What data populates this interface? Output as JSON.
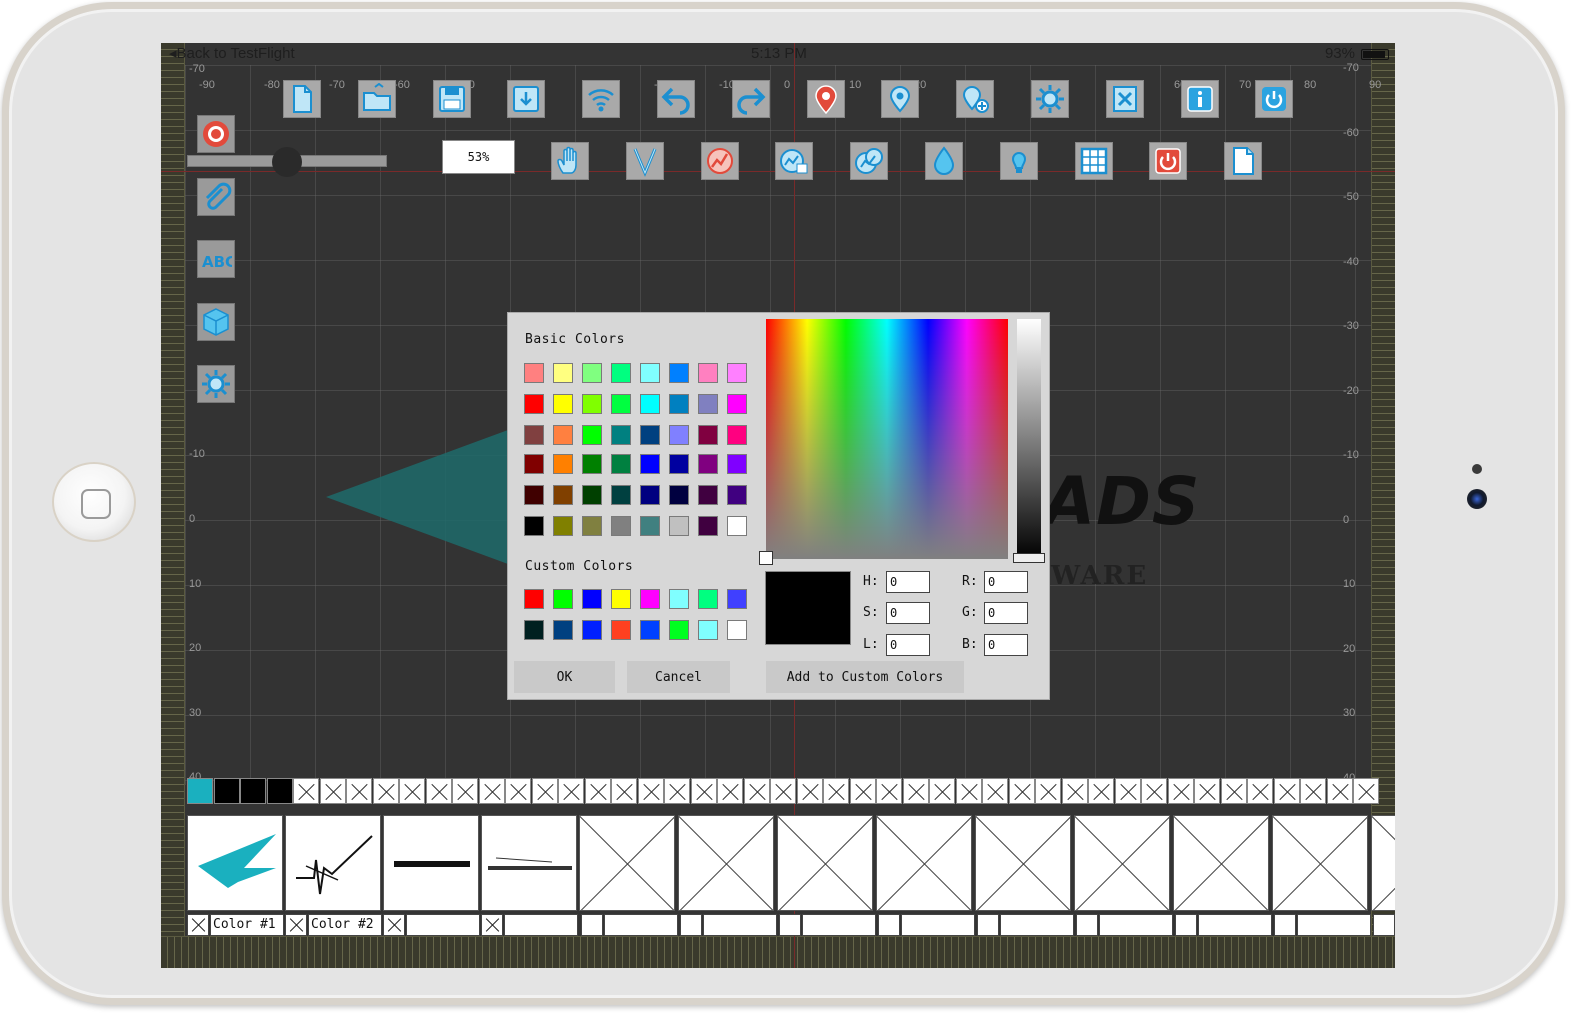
{
  "status_bar": {
    "back": "Back to TestFlight",
    "time": "5:13 PM",
    "battery": "93%"
  },
  "ruler": {
    "top": [
      "-90",
      "-80",
      "-70",
      "-60",
      "-50",
      "-40",
      "-30",
      "-20",
      "-10",
      "0",
      "10",
      "20",
      "30",
      "40",
      "50",
      "60",
      "70",
      "80",
      "90"
    ],
    "right": [
      "-70",
      "-60",
      "-50",
      "-40",
      "-30",
      "-20",
      "-10",
      "0",
      "10",
      "20",
      "30",
      "40"
    ],
    "left": [
      "-70",
      "-10",
      "0",
      "10",
      "20",
      "30",
      "40"
    ]
  },
  "toolbar": {
    "row1": [
      "new-file-icon",
      "open-folder-icon",
      "save-icon",
      "save-as-icon",
      "wireless-icon",
      "undo-icon",
      "redo-icon",
      "map-pin-icon",
      "location-icon",
      "add-location-icon",
      "settings-gear-icon",
      "close-file-icon",
      "info-icon",
      "power-icon"
    ],
    "row2": [
      "hand-icon",
      "needle-v-icon",
      "stitch-curve-icon",
      "stitch-chart-icon",
      "stitch-loop-icon",
      "color-drop-icon",
      "bulb-icon",
      "grid-icon",
      "power-off-icon",
      "page-icon"
    ]
  },
  "side_toolbar": [
    "target-icon",
    "paperclip-icon",
    "abc-text-icon",
    "cube-icon",
    "gear-icon"
  ],
  "zoom": {
    "value": "53%",
    "slider_level": 0.5
  },
  "artwork": {
    "text_main": "ADS",
    "text_sub": "WARE"
  },
  "color_dialog": {
    "basic_colors_label": "Basic Colors",
    "custom_colors_label": "Custom Colors",
    "basic_colors": [
      [
        "#ff8080",
        "#ffff80",
        "#80ff80",
        "#00ff80",
        "#80ffff",
        "#0080ff",
        "#ff80c0",
        "#ff80ff"
      ],
      [
        "#ff0000",
        "#ffff00",
        "#80ff00",
        "#00ff40",
        "#00ffff",
        "#0080c0",
        "#8080c0",
        "#ff00ff"
      ],
      [
        "#804040",
        "#ff8040",
        "#00ff00",
        "#008080",
        "#004080",
        "#8080ff",
        "#800040",
        "#ff0080"
      ],
      [
        "#800000",
        "#ff8000",
        "#008000",
        "#008040",
        "#0000ff",
        "#0000a0",
        "#800080",
        "#8000ff"
      ],
      [
        "#400000",
        "#804000",
        "#004000",
        "#004040",
        "#000080",
        "#000040",
        "#400040",
        "#400080"
      ],
      [
        "#000000",
        "#808000",
        "#808040",
        "#808080",
        "#408080",
        "#c0c0c0",
        "#400040",
        "#ffffff"
      ]
    ],
    "custom_colors": [
      [
        "#ff0000",
        "#00ff00",
        "#0000ff",
        "#ffff00",
        "#ff00ff",
        "#80ffff",
        "#00ff80",
        "#4040ff"
      ],
      [
        "#002020",
        "#004080",
        "#0020ff",
        "#ff4020",
        "#0040ff",
        "#00ff20",
        "#80ffff",
        "#ffffff"
      ]
    ],
    "fields": {
      "h_label": "H:",
      "h_value": "0",
      "s_label": "S:",
      "s_value": "0",
      "l_label": "L:",
      "l_value": "0",
      "r_label": "R:",
      "r_value": "0",
      "g_label": "G:",
      "g_value": "0",
      "b_label": "B:",
      "b_value": "0"
    },
    "ok_label": "OK",
    "cancel_label": "Cancel",
    "add_custom_label": "Add to Custom Colors",
    "preview_color": "#000000"
  },
  "color_strip": {
    "filled": [
      "#1ab0bf",
      "#000000",
      "#000000",
      "#000000",
      "#000000"
    ],
    "empty_count": 41
  },
  "threads": {
    "label_1": "Color #1",
    "label_2": "Color #2"
  }
}
